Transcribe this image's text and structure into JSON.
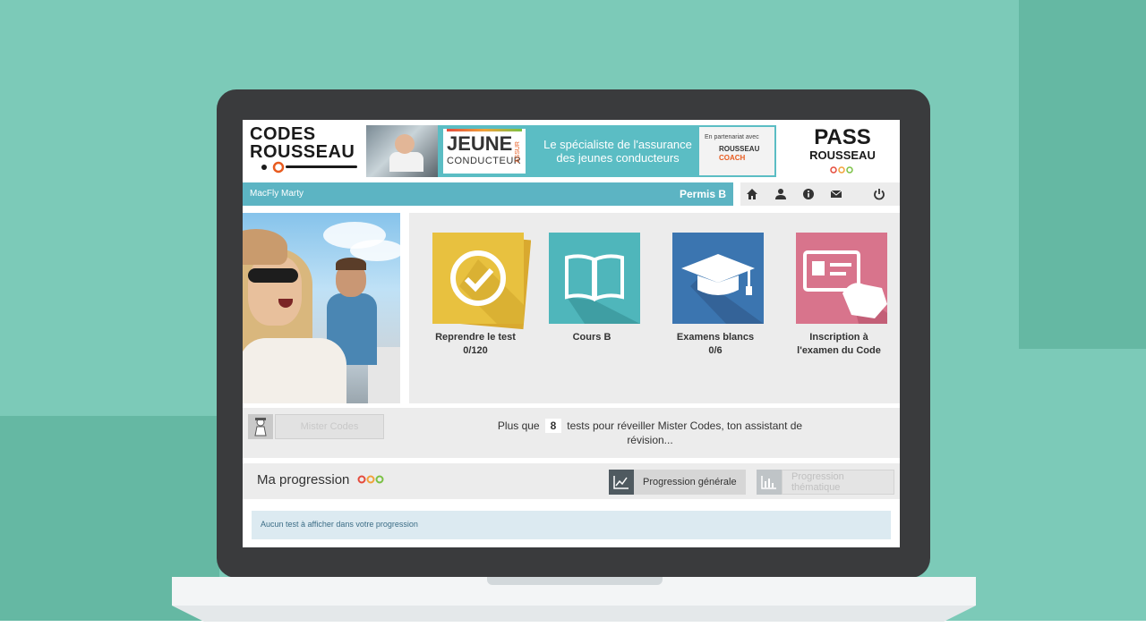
{
  "header": {
    "logo_codes_line1": "CODES",
    "logo_codes_line2": "ROUSSEAU",
    "banner_brand_line1": "JEUNE",
    "banner_brand_line2": "CONDUCTEUR",
    "banner_brand_tag": "ASSUR",
    "banner_text": "Le spécialiste de l'assurance des jeunes conducteurs",
    "partner_line1": "En partenariat avec",
    "partner_line2": "ROUSSEAU",
    "partner_line3": "COACH",
    "logo_pass_line1": "PASS",
    "logo_pass_line2": "ROUSSEAU"
  },
  "navbar": {
    "user": "MacFly Marty",
    "permis": "Permis B",
    "icons": [
      "home-icon",
      "user-icon",
      "info-icon",
      "mail-icon",
      "power-icon"
    ]
  },
  "tiles": [
    {
      "label": "Reprendre le test",
      "sub": "0/120",
      "color": "#e8c13f",
      "icon": "checkmark-icon"
    },
    {
      "label": "Cours B",
      "sub": "",
      "color": "#4fb6bb",
      "icon": "book-icon"
    },
    {
      "label": "Examens blancs",
      "sub": "0/6",
      "color": "#3b75b0",
      "icon": "graduation-cap-icon"
    },
    {
      "label": "Inscription à",
      "sub": "l'examen du Code",
      "color": "#d8748c",
      "icon": "id-card-icon"
    }
  ],
  "mister": {
    "button_label": "Mister Codes",
    "msg_before": "Plus que",
    "count": "8",
    "msg_after": "tests pour réveiller Mister Codes, ton assistant de révision..."
  },
  "progression": {
    "title": "Ma progression",
    "btn_generale": "Progression générale",
    "btn_thematique": "Progression thématique",
    "empty_msg": "Aucun test à afficher dans votre progression"
  },
  "colors": {
    "background": "#7ccab8",
    "navbar": "#5cb4c3",
    "accent_red": "#e54b3c"
  }
}
